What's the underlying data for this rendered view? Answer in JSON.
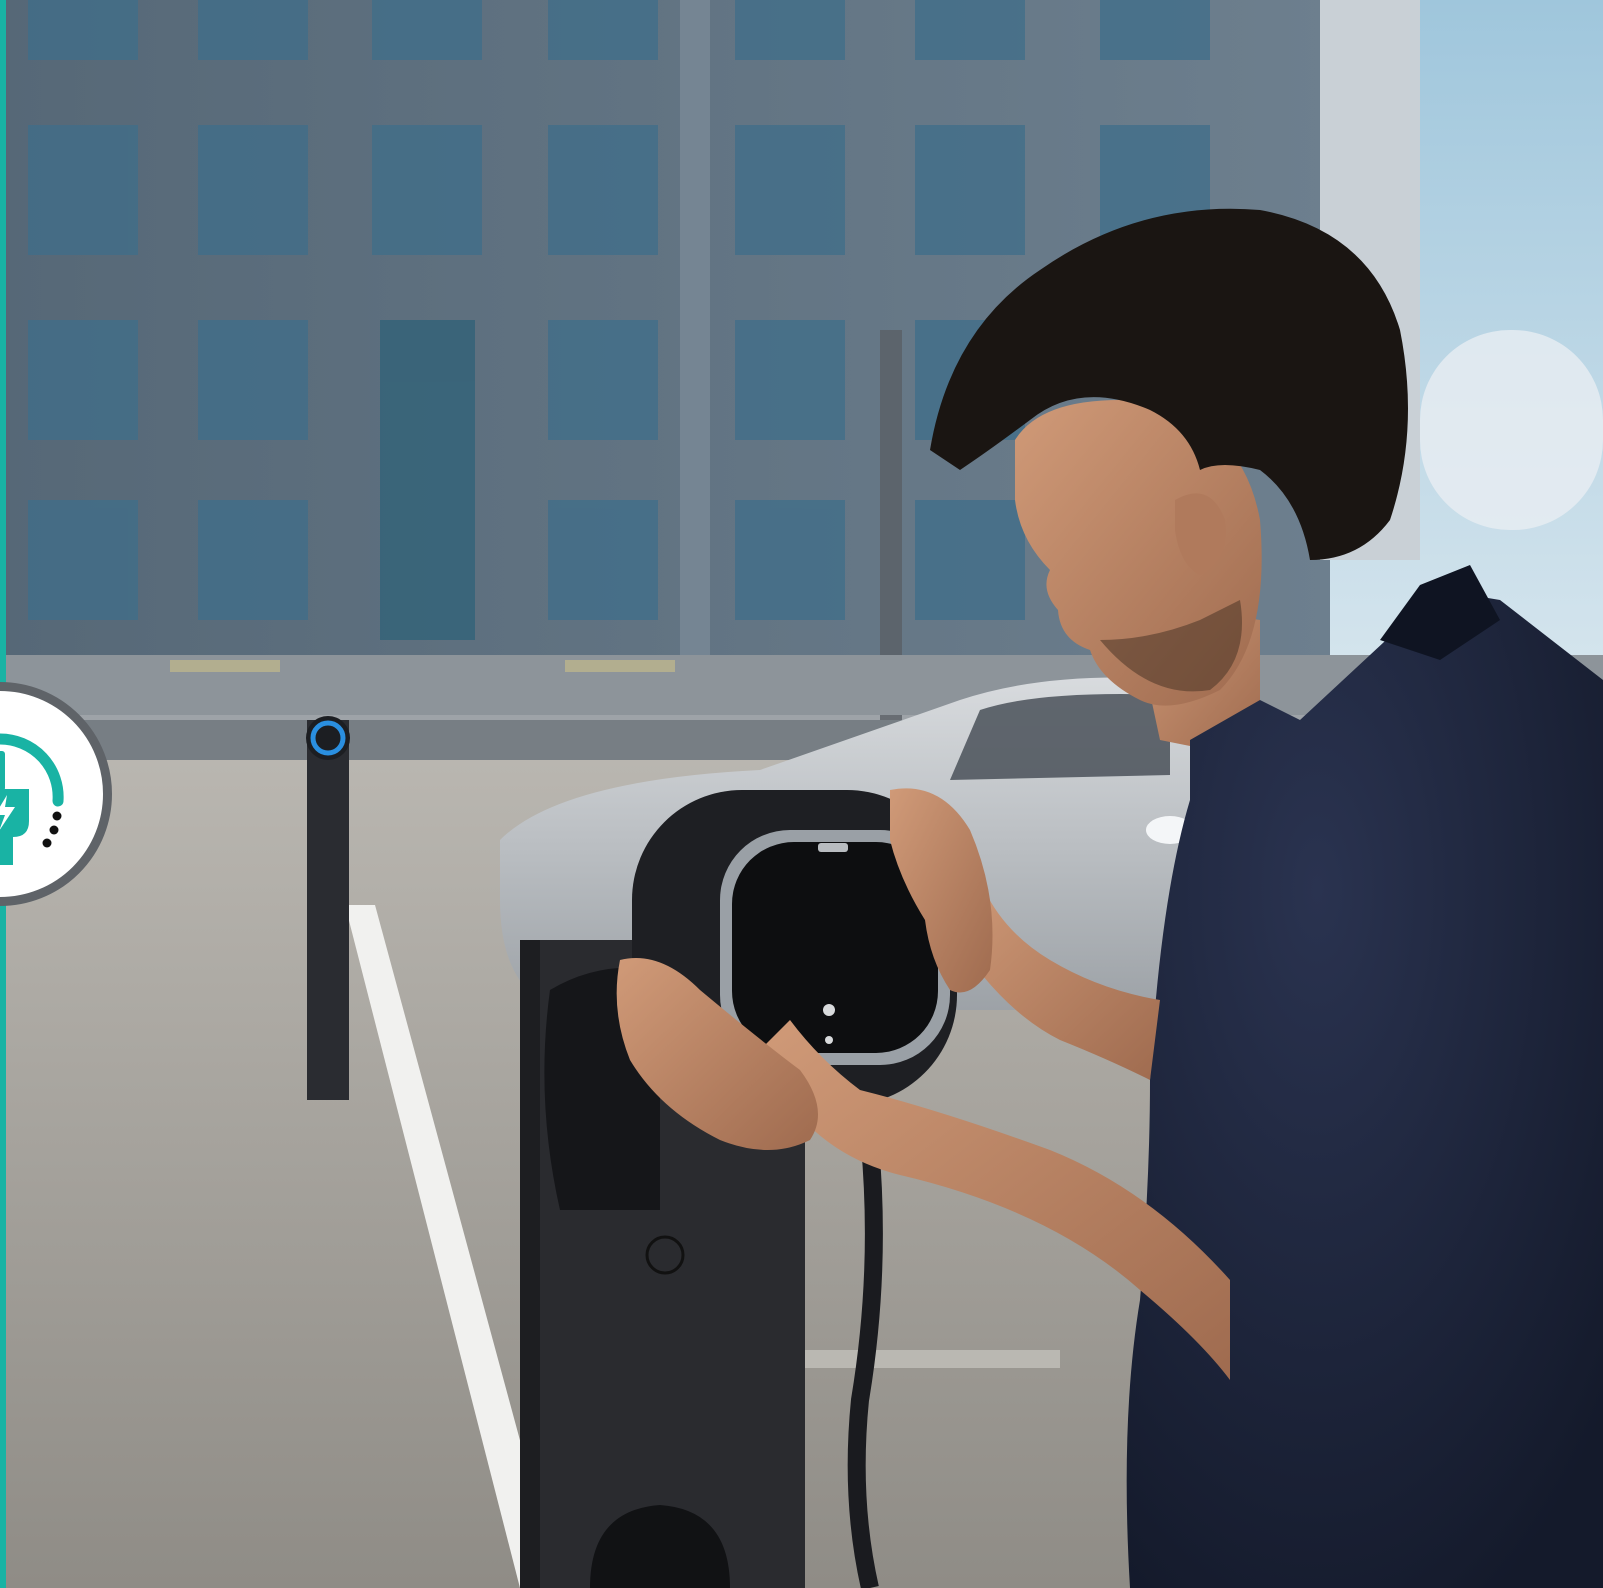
{
  "colors": {
    "accent": "#19b3a4",
    "badge_ring": "#5f6368",
    "badge_fill": "#ffffff",
    "sky": "#aecfe2",
    "building": "#5e7081",
    "window": "#3f6e8a",
    "ground": "#a8a49d",
    "shirt": "#1b2236",
    "skin": "#c08a69",
    "hair": "#1a1512",
    "charger": "#1a1b1f",
    "car": "#c9ccd0"
  },
  "icons": {
    "badge": "ev-charging-plug-icon"
  }
}
